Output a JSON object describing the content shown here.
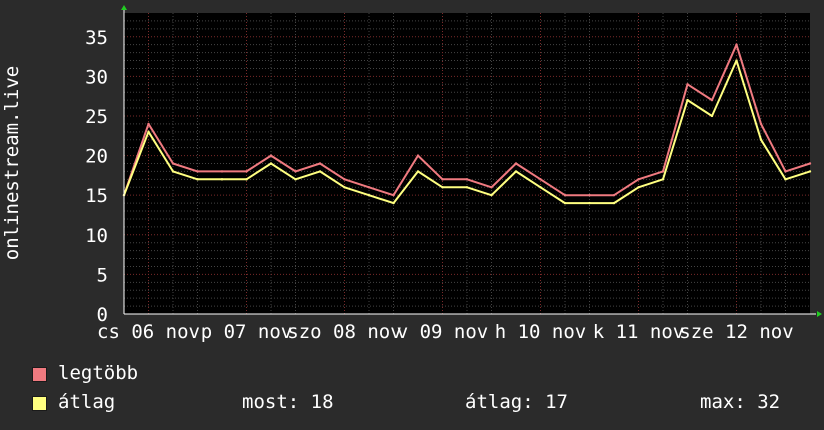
{
  "chart_data": {
    "type": "line",
    "ylabel": "onlinestream.live",
    "ylim": [
      0,
      38
    ],
    "yticks": [
      0,
      5,
      10,
      15,
      20,
      25,
      30,
      35
    ],
    "xticks": [
      "cs 06 nov",
      "p 07 nov",
      "szo 08 nov",
      "v 09 nov",
      "h 10 nov",
      "k 11 nov",
      "sze 12 nov"
    ],
    "grid": true,
    "colors": {
      "background": "#000000",
      "canvas": "#2b2b2b",
      "grid_major": "#7a2a2a",
      "grid_minor": "#444444",
      "axis": "#ffffff"
    },
    "x": [
      0,
      0.25,
      0.5,
      0.75,
      1,
      1.25,
      1.5,
      1.75,
      2,
      2.25,
      2.5,
      2.75,
      3,
      3.25,
      3.5,
      3.75,
      4,
      4.25,
      4.5,
      4.75,
      5,
      5.25,
      5.5,
      5.75,
      6,
      6.25,
      6.5,
      6.75,
      7
    ],
    "series": [
      {
        "name": "legtöbb",
        "color": "#f07a80",
        "values": [
          15,
          24,
          19,
          18,
          18,
          18,
          20,
          18,
          19,
          17,
          16,
          15,
          20,
          17,
          17,
          16,
          19,
          17,
          15,
          15,
          15,
          17,
          18,
          29,
          27,
          34,
          24,
          18,
          19
        ]
      },
      {
        "name": "átlag",
        "color": "#ffff80",
        "values": [
          15,
          23,
          18,
          17,
          17,
          17,
          19,
          17,
          18,
          16,
          15,
          14,
          18,
          16,
          16,
          15,
          18,
          16,
          14,
          14,
          14,
          16,
          17,
          27,
          25,
          32,
          22,
          17,
          18
        ]
      }
    ]
  },
  "legend": {
    "max_label": "legtöbb",
    "avg_label": "átlag",
    "now": "most: 18",
    "avg": "átlag: 17",
    "max": "max: 32"
  }
}
